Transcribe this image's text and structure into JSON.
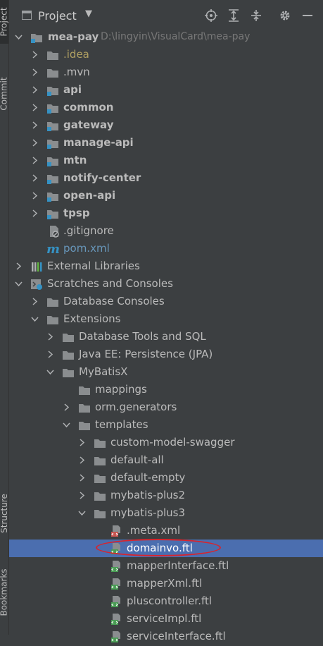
{
  "sidebar": {
    "project_tab": "Project",
    "commit_tab": "Commit",
    "structure_tab": "Structure",
    "bookmarks_tab": "Bookmarks"
  },
  "toolbar": {
    "title": "Project"
  },
  "tree": {
    "root": {
      "label": "mea-pay",
      "path": "D:\\lingyin\\VisualCard\\mea-pay"
    },
    "modules": [
      ".idea",
      ".mvn",
      "api",
      "common",
      "gateway",
      "manage-api",
      "mtn",
      "notify-center",
      "open-api",
      "tpsp"
    ],
    "files": [
      ".gitignore",
      "pom.xml"
    ],
    "external_libraries": "External Libraries",
    "scratches": "Scratches and Consoles",
    "database_consoles": "Database Consoles",
    "extensions": "Extensions",
    "ext_children": [
      "Database Tools and SQL",
      "Java EE: Persistence (JPA)",
      "MyBatisX"
    ],
    "mybatisx_children": [
      "mappings",
      "orm.generators",
      "templates"
    ],
    "template_folders": [
      "custom-model-swagger",
      "default-all",
      "default-empty",
      "mybatis-plus2",
      "mybatis-plus3"
    ],
    "mp3_files": [
      ".meta.xml",
      "domainvo.ftl",
      "mapperInterface.ftl",
      "mapperXml.ftl",
      "pluscontroller.ftl",
      "serviceImpl.ftl",
      "serviceInterface.ftl"
    ]
  },
  "colors": {
    "selection": "#4b6eaf",
    "highlight_ellipse": "#d8242d",
    "idea_label": "#b0a062",
    "pom_label": "#6897bb"
  }
}
